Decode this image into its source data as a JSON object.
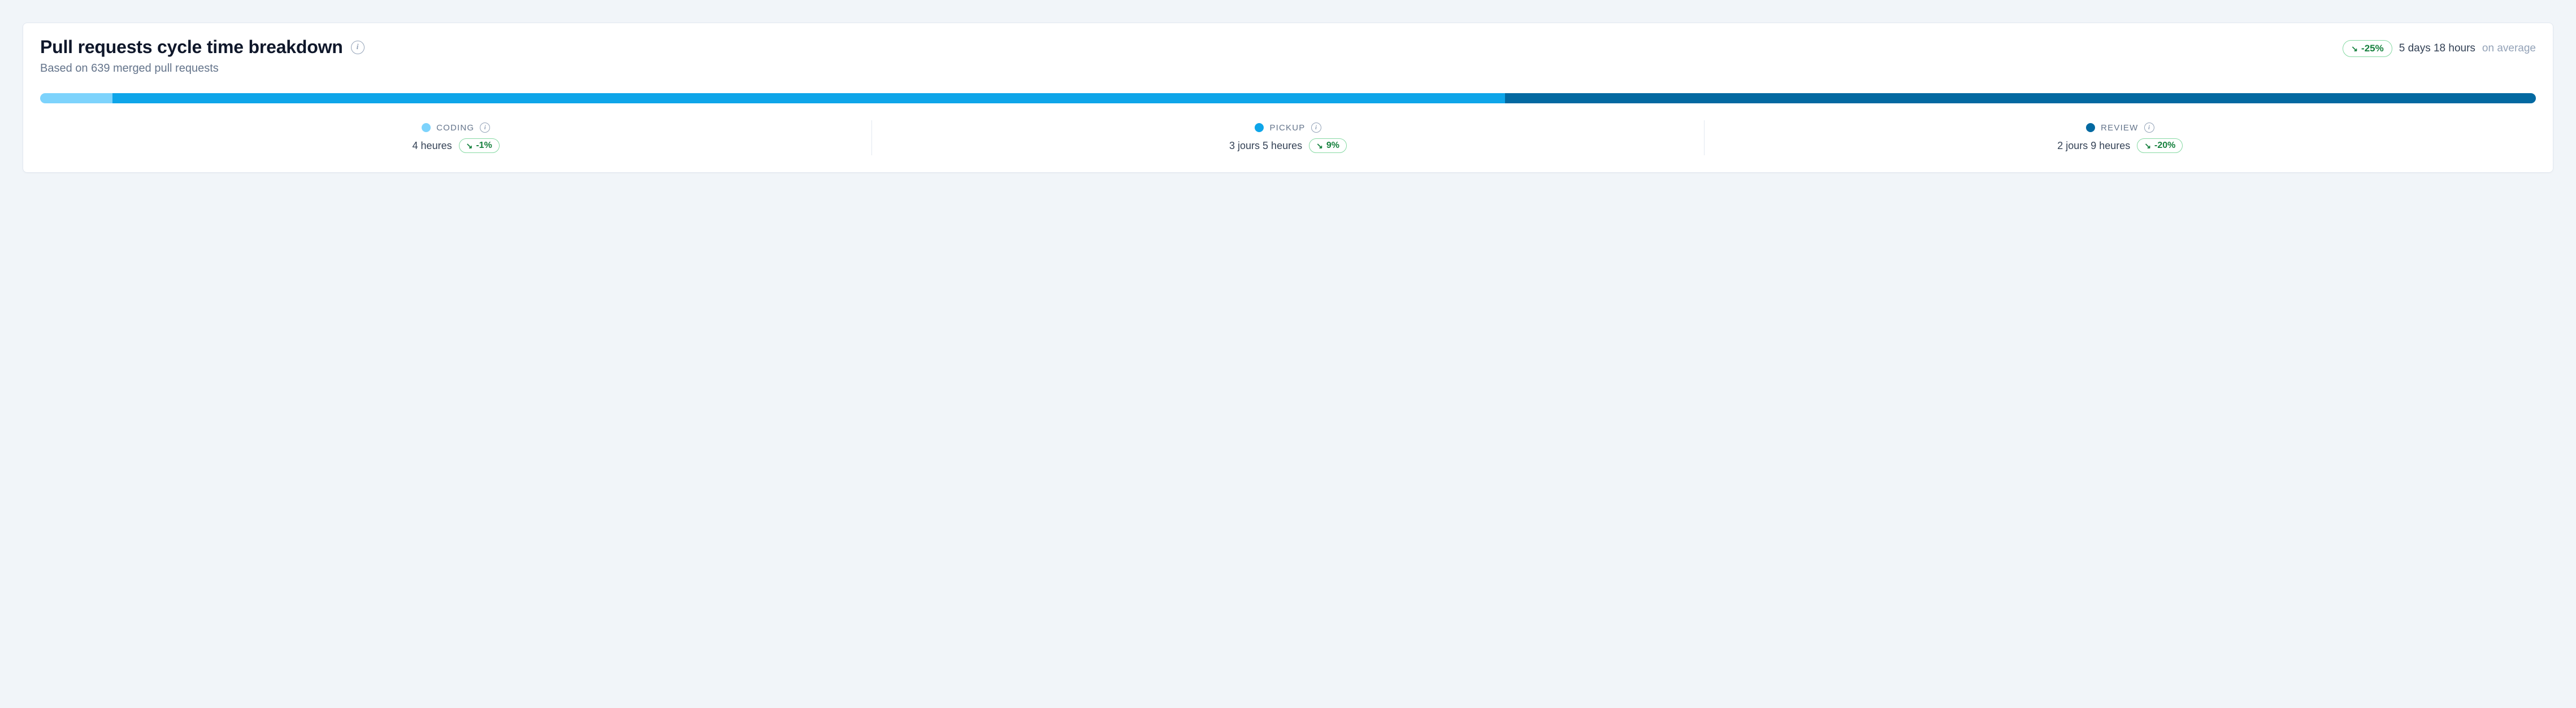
{
  "title": "Pull requests cycle time breakdown",
  "subtitle": "Based on 639 merged pull requests",
  "summary": {
    "delta": "-25%",
    "direction": "down",
    "value": "5 days 18 hours",
    "suffix": "on average"
  },
  "colors": {
    "coding": "#7dd3fc",
    "pickup": "#0ea5e9",
    "review": "#0369a1",
    "positive": "#15803d",
    "positive_border": "#86d9a3"
  },
  "chart_data": {
    "type": "bar",
    "title": "Pull requests cycle time breakdown",
    "series": [
      {
        "name": "CODING",
        "hours": 4,
        "percent": 2.9,
        "delta_pct": -1
      },
      {
        "name": "PICKUP",
        "hours": 77,
        "percent": 55.8,
        "delta_pct": 9
      },
      {
        "name": "REVIEW",
        "hours": 57,
        "percent": 41.3,
        "delta_pct": -20
      }
    ],
    "total_hours": 138,
    "unit": "hours"
  },
  "stages": [
    {
      "key": "coding",
      "label": "CODING",
      "value": "4 heures",
      "delta": "-1%",
      "direction": "down",
      "width_pct": 2.9
    },
    {
      "key": "pickup",
      "label": "PICKUP",
      "value": "3 jours 5 heures",
      "delta": "9%",
      "direction": "down",
      "width_pct": 55.8
    },
    {
      "key": "review",
      "label": "REVIEW",
      "value": "2 jours 9 heures",
      "delta": "-20%",
      "direction": "down",
      "width_pct": 41.3
    }
  ]
}
